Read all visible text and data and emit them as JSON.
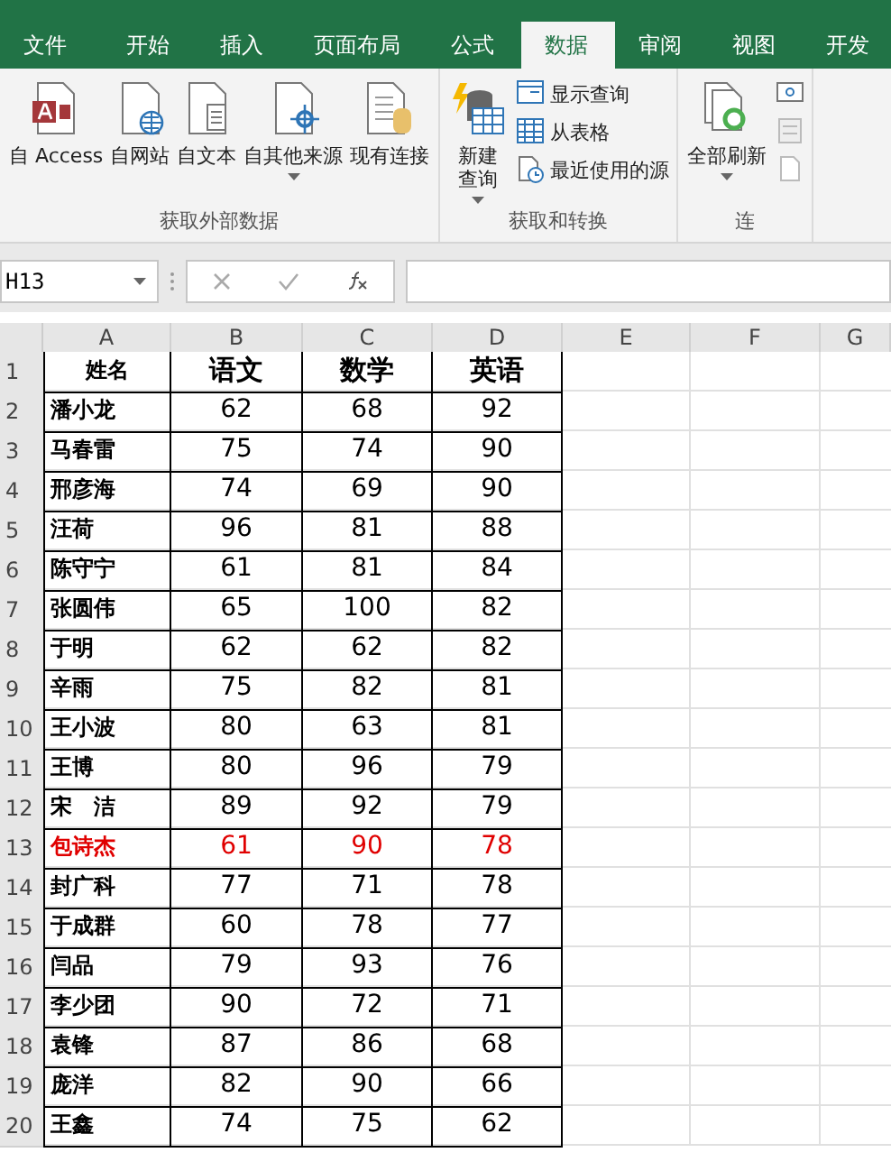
{
  "tabs": [
    {
      "label": "文件",
      "selected": false
    },
    {
      "label": "开始",
      "selected": false
    },
    {
      "label": "插入",
      "selected": false
    },
    {
      "label": "页面布局",
      "selected": false
    },
    {
      "label": "公式",
      "selected": false
    },
    {
      "label": "数据",
      "selected": true
    },
    {
      "label": "审阅",
      "selected": false
    },
    {
      "label": "视图",
      "selected": false
    },
    {
      "label": "开发",
      "selected": false
    }
  ],
  "ribbon": {
    "groups": [
      {
        "title": "获取外部数据",
        "buttons": [
          {
            "kind": "access",
            "label": "自 Access"
          },
          {
            "kind": "web",
            "label": "自网站"
          },
          {
            "kind": "text",
            "label": "自文本"
          },
          {
            "kind": "other",
            "label": "自其他来源",
            "dropdown": true
          },
          {
            "kind": "conn",
            "label": "现有连接"
          }
        ]
      },
      {
        "title": "获取和转换",
        "buttons": [
          {
            "kind": "query",
            "label": "新建查询",
            "dropdown": true
          }
        ],
        "small": [
          {
            "kind": "show",
            "label": "显示查询"
          },
          {
            "kind": "table",
            "label": "从表格"
          },
          {
            "kind": "recent",
            "label": "最近使用的源"
          }
        ]
      },
      {
        "title": "连",
        "buttons": [
          {
            "kind": "refresh",
            "label": "全部刷新",
            "dropdown": true
          }
        ],
        "small": [
          {
            "kind": "i1"
          },
          {
            "kind": "i2"
          },
          {
            "kind": "i3"
          }
        ]
      }
    ]
  },
  "name_box": "H13",
  "columns": [
    "A",
    "B",
    "C",
    "D",
    "E",
    "F",
    "G"
  ],
  "header": {
    "row": "1",
    "cells": [
      "姓名",
      "语文",
      "数学",
      "英语"
    ]
  },
  "rows": [
    {
      "row": "2",
      "highlighted": false,
      "cells": [
        "潘小龙",
        "62",
        "68",
        "92"
      ]
    },
    {
      "row": "3",
      "highlighted": false,
      "cells": [
        "马春雷",
        "75",
        "74",
        "90"
      ]
    },
    {
      "row": "4",
      "highlighted": false,
      "cells": [
        "邢彦海",
        "74",
        "69",
        "90"
      ]
    },
    {
      "row": "5",
      "highlighted": false,
      "cells": [
        "汪荷",
        "96",
        "81",
        "88"
      ]
    },
    {
      "row": "6",
      "highlighted": false,
      "cells": [
        "陈守宁",
        "61",
        "81",
        "84"
      ]
    },
    {
      "row": "7",
      "highlighted": false,
      "cells": [
        "张圆伟",
        "65",
        "100",
        "82"
      ]
    },
    {
      "row": "8",
      "highlighted": false,
      "cells": [
        "于明",
        "62",
        "62",
        "82"
      ]
    },
    {
      "row": "9",
      "highlighted": false,
      "cells": [
        "辛雨",
        "75",
        "82",
        "81"
      ]
    },
    {
      "row": "10",
      "highlighted": false,
      "cells": [
        "王小波",
        "80",
        "63",
        "81"
      ]
    },
    {
      "row": "11",
      "highlighted": false,
      "cells": [
        "王博",
        "80",
        "96",
        "79"
      ]
    },
    {
      "row": "12",
      "highlighted": false,
      "cells": [
        "宋　洁",
        "89",
        "92",
        "79"
      ]
    },
    {
      "row": "13",
      "highlighted": true,
      "cells": [
        "包诗杰",
        "61",
        "90",
        "78"
      ]
    },
    {
      "row": "14",
      "highlighted": false,
      "cells": [
        "封广科",
        "77",
        "71",
        "78"
      ]
    },
    {
      "row": "15",
      "highlighted": false,
      "cells": [
        "于成群",
        "60",
        "78",
        "77"
      ]
    },
    {
      "row": "16",
      "highlighted": false,
      "cells": [
        "闫品",
        "79",
        "93",
        "76"
      ]
    },
    {
      "row": "17",
      "highlighted": false,
      "cells": [
        "李少团",
        "90",
        "72",
        "71"
      ]
    },
    {
      "row": "18",
      "highlighted": false,
      "cells": [
        "袁锋",
        "87",
        "86",
        "68"
      ]
    },
    {
      "row": "19",
      "highlighted": false,
      "cells": [
        "庞洋",
        "82",
        "90",
        "66"
      ]
    },
    {
      "row": "20",
      "highlighted": false,
      "cells": [
        "王鑫",
        "74",
        "75",
        "62"
      ]
    }
  ]
}
